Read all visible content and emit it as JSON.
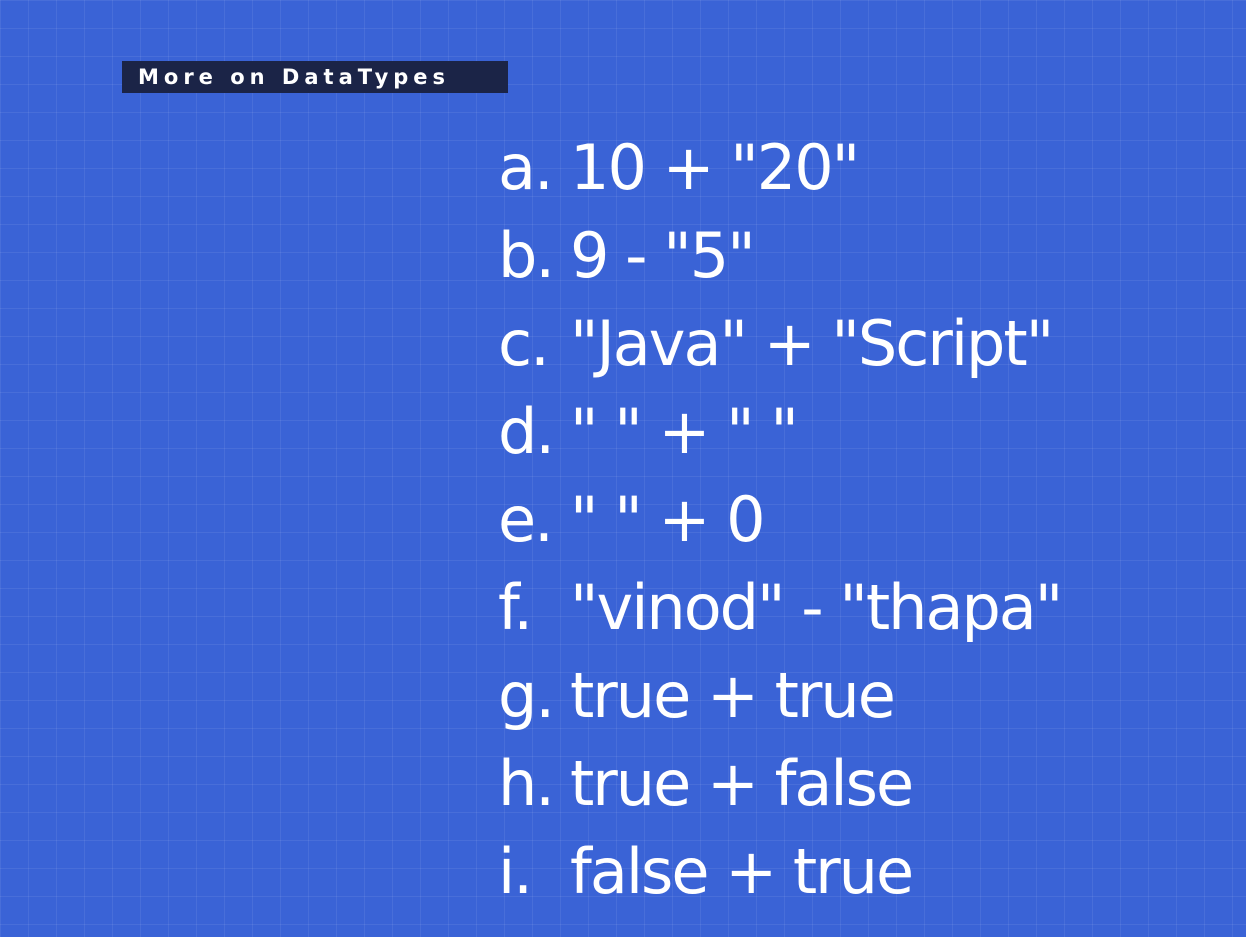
{
  "slide": {
    "tag_label": "More on DataTypes",
    "items": [
      {
        "marker": "a.",
        "expression": "10 + \"20\""
      },
      {
        "marker": "b.",
        "expression": "9 - \"5\""
      },
      {
        "marker": "c.",
        "expression": "\"Java\" + \"Script\""
      },
      {
        "marker": "d.",
        "expression": "\" \" + \" \""
      },
      {
        "marker": "e.",
        "expression": "\" \" + 0"
      },
      {
        "marker": "f.",
        "expression": "\"vinod\" - \"thapa\""
      },
      {
        "marker": "g.",
        "expression": "true + true"
      },
      {
        "marker": "h.",
        "expression": "true + false"
      },
      {
        "marker": "i.",
        "expression": "false + true"
      }
    ]
  },
  "colors": {
    "background": "#3a63d6",
    "tag_background": "#1b2447",
    "text": "#ffffff"
  }
}
